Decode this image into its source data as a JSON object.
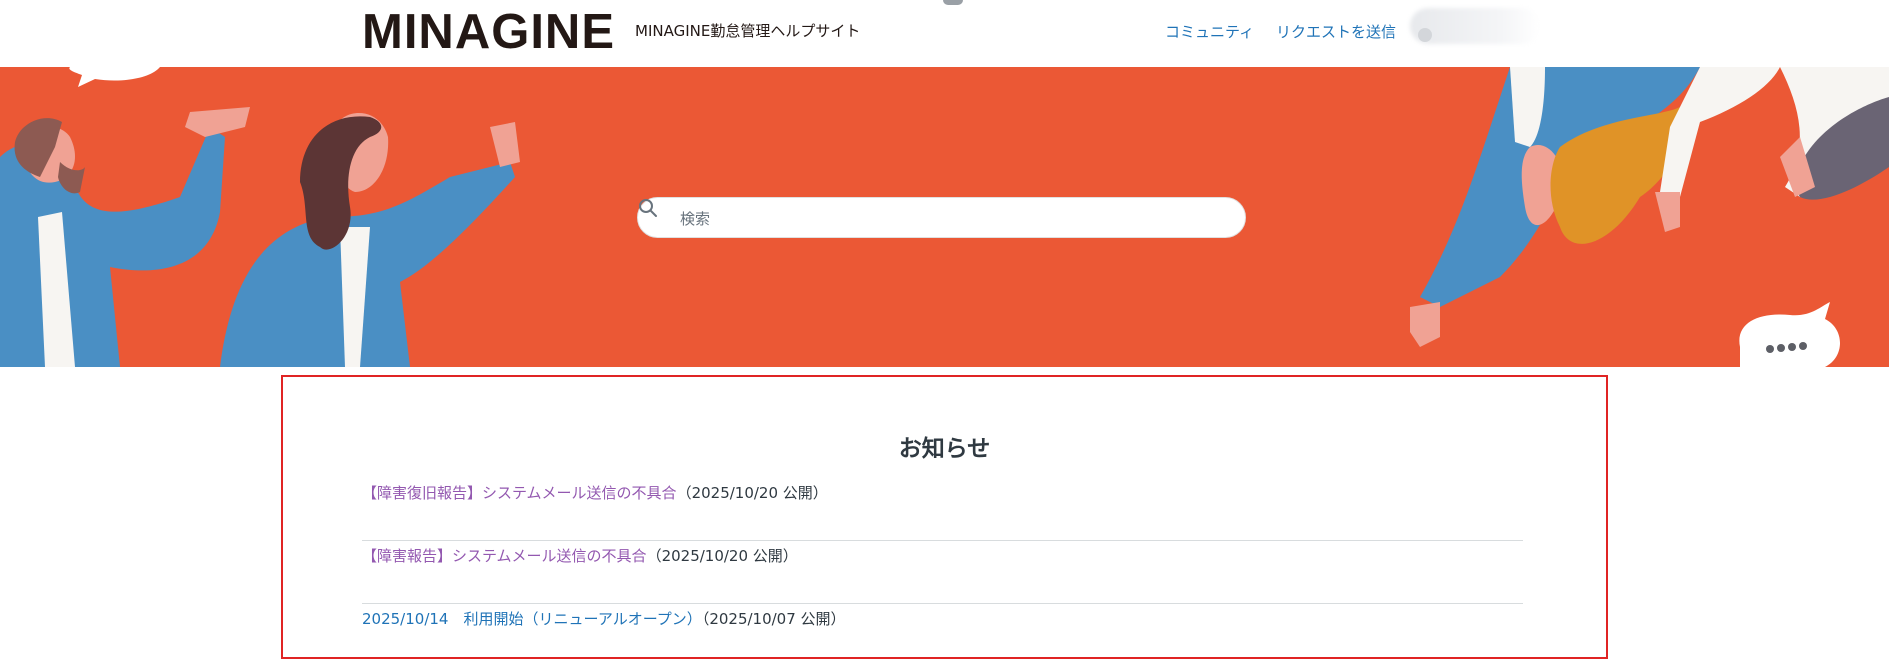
{
  "header": {
    "logo_text": "MINAGINE",
    "site_name": "MINAGINE勤怠管理ヘルプサイト",
    "nav": {
      "community": "コミュニティ",
      "request": "リクエストを送信"
    },
    "user_menu_icon": "avatar-icon"
  },
  "hero": {
    "search": {
      "placeholder": "検索",
      "icon": "search-icon"
    },
    "background_color": "#eb5835",
    "speech_bubble_text": "●●●●"
  },
  "notices": {
    "title": "お知らせ",
    "items": [
      {
        "link": "【障害復旧報告】システムメール送信の不具合",
        "meta": "（2025/10/20 公開）"
      },
      {
        "link": "【障害報告】システムメール送信の不具合",
        "meta": "（2025/10/20 公開）"
      },
      {
        "link": "2025/10/14　利用開始（リニューアルオープン）",
        "meta": "（2025/10/07 公開）"
      }
    ]
  },
  "colors": {
    "link": "#1f73b7",
    "visited_link": "#9358b0",
    "highlight_border": "#e02424"
  }
}
